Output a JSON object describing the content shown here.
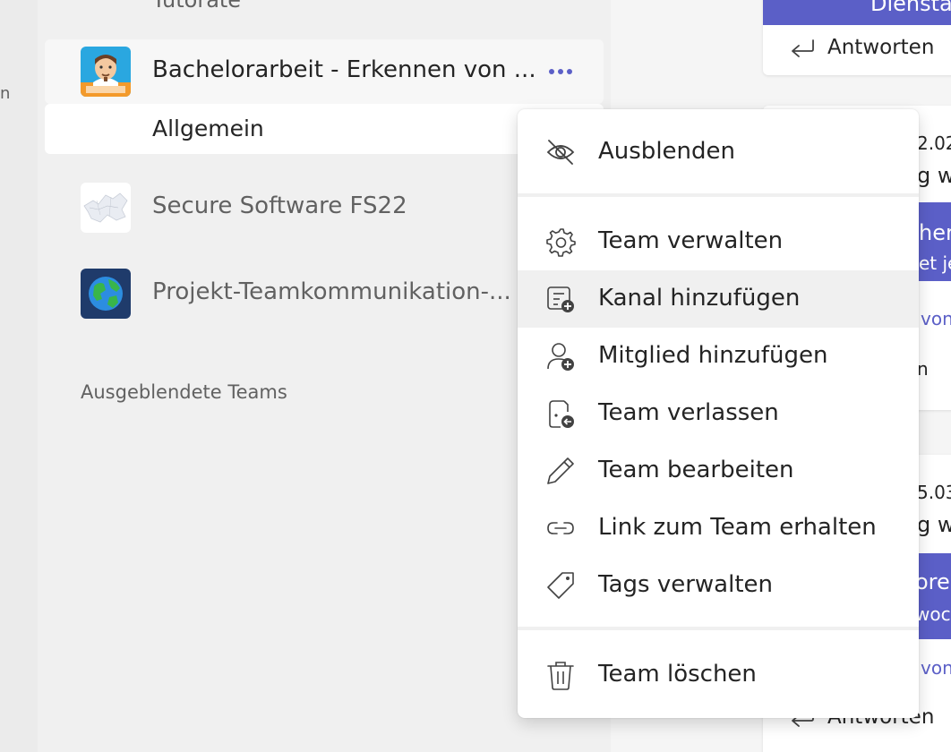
{
  "rail": {
    "fragment": "n"
  },
  "team_list": {
    "top_fragment": "Tutorate",
    "teams": [
      {
        "name": "Bachelorarbeit - Erkennen von ...",
        "avatar": "shakespeare-avatar",
        "channel": "Allgemein"
      },
      {
        "name": "Secure Software FS22",
        "avatar": "map-sketch-avatar"
      },
      {
        "name": "Projekt-Teamkommunikation-...",
        "avatar": "globe-avatar"
      }
    ],
    "hidden_teams_label": "Ausgeblendete Teams"
  },
  "context_menu": {
    "items": [
      {
        "label": "Ausblenden",
        "icon": "eye-off-icon"
      },
      {
        "label": "Team verwalten",
        "icon": "gear-icon"
      },
      {
        "label": "Kanal hinzufügen",
        "icon": "add-channel-icon"
      },
      {
        "label": "Mitglied hinzufügen",
        "icon": "add-member-icon"
      },
      {
        "label": "Team verlassen",
        "icon": "leave-team-icon"
      },
      {
        "label": "Team bearbeiten",
        "icon": "pencil-icon"
      },
      {
        "label": "Link zum Team erhalten",
        "icon": "link-icon"
      },
      {
        "label": "Tags verwalten",
        "icon": "tag-icon"
      },
      {
        "label": "Team löschen",
        "icon": "trash-icon"
      }
    ],
    "highlighted": "Kanal hinzufügen"
  },
  "conversation": {
    "top_banner_fragment": "Dienstag",
    "reply_label": "Antworten",
    "date1_fragment": "2.02",
    "text1_fragment": "g w",
    "purple1_line1": "hen",
    "purple1_line2": "et je",
    "link1_fragment": "von",
    "text2_fragment": "n",
    "date2_fragment": "5.03",
    "text3_fragment": "g w",
    "purple2_line1": "orec",
    "purple2_line2": "woch",
    "link2_fragment": "von",
    "bottom_reply_label": "Antworten"
  },
  "colors": {
    "accent": "#5b5fc7",
    "panel": "#f0f0f0",
    "menu_hover": "#f0f0f0"
  }
}
